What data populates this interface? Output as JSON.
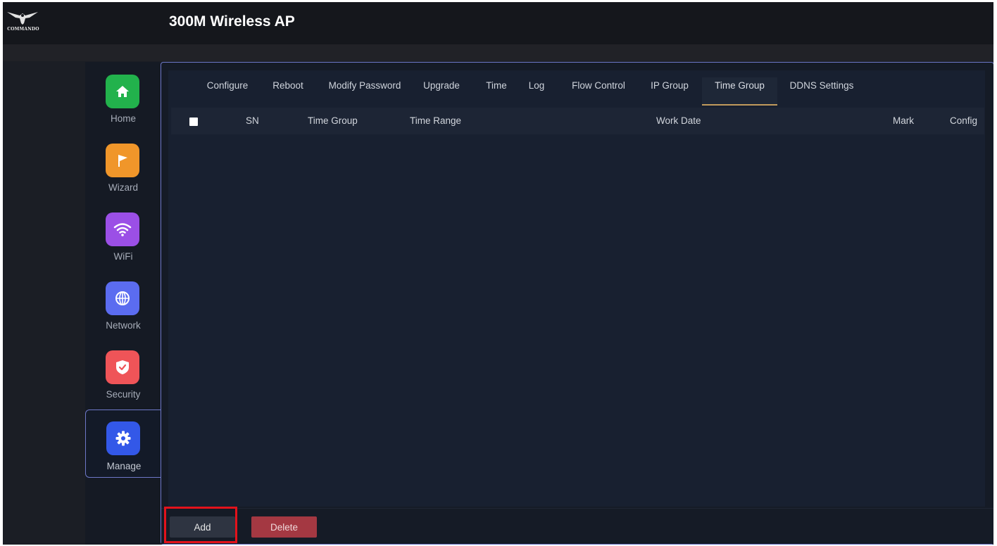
{
  "header": {
    "logo_text": "COMMANDO",
    "title": "300M Wireless AP"
  },
  "sidebar": {
    "items": [
      {
        "label": "Home",
        "icon": "home-icon",
        "color": "#22b24c"
      },
      {
        "label": "Wizard",
        "icon": "flag-icon",
        "color": "#f0962a"
      },
      {
        "label": "WiFi",
        "icon": "wifi-icon",
        "color": "#9b4fe6"
      },
      {
        "label": "Network",
        "icon": "globe-icon",
        "color": "#5b6cf0"
      },
      {
        "label": "Security",
        "icon": "shield-icon",
        "color": "#ef5458"
      },
      {
        "label": "Manage",
        "icon": "gear-icon",
        "color": "#3358e8",
        "active": true
      }
    ]
  },
  "tabs": [
    {
      "label": "Configure"
    },
    {
      "label": "Reboot"
    },
    {
      "label": "Modify Password"
    },
    {
      "label": "Upgrade"
    },
    {
      "label": "Time"
    },
    {
      "label": "Log"
    },
    {
      "label": "Flow Control"
    },
    {
      "label": "IP Group"
    },
    {
      "label": "Time Group",
      "active": true
    },
    {
      "label": "DDNS Settings"
    }
  ],
  "table": {
    "columns": [
      "SN",
      "Time Group",
      "Time Range",
      "Work Date",
      "Mark",
      "Config"
    ],
    "rows": []
  },
  "buttons": {
    "add_label": "Add",
    "delete_label": "Delete"
  },
  "colors": {
    "accent_border": "#6e78c8",
    "active_tab_underline": "#c29b5c",
    "delete_button": "#a43842",
    "highlight_box": "#e3121b"
  }
}
